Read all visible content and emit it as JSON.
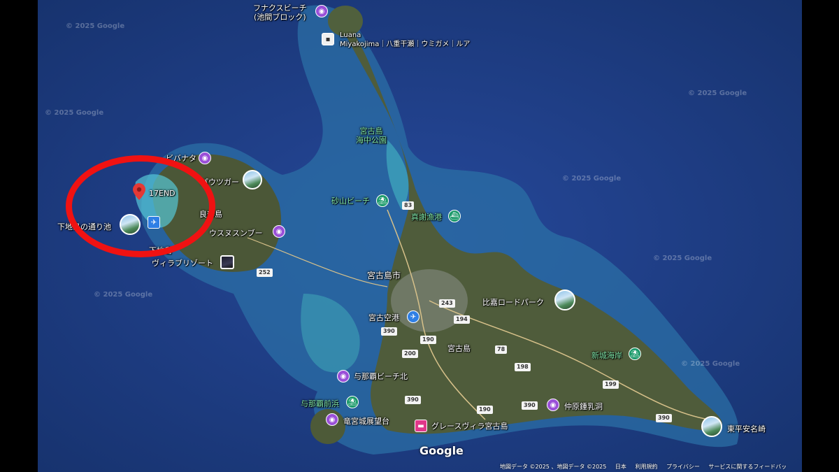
{
  "colors": {
    "water": "#1c3e86",
    "land": "#4b5a3a",
    "reef": "#43b4c8",
    "circle": "#f01212"
  },
  "places": {
    "funakusu": "フナクスビーチ\n(池間ブロック)",
    "luana": "Luana\nMiyakojima｜八重干瀬｜ウミガメ｜ルア",
    "kaichu_park": "宮古島\n海中公園",
    "sunayama": "砂山ビーチ",
    "shinjya": "真謝漁港",
    "marker_17end": "17END",
    "shimojishima_pond": "下地島の通り池",
    "irabu": "良部島",
    "usunu": "ウスヌスンブー",
    "shimojishima": "下地島",
    "villa": "ヴィラブリゾート",
    "bibanata": "ビバナタ",
    "pausoga": "パウツガー",
    "miyakojima_city": "宮古島市",
    "miyako_airport": "宮古空港",
    "miyakojima": "宮古島",
    "higa_road_park": "比嘉ロードパーク",
    "shinjo_beach": "新城海岸",
    "yonaha_north": "与那覇ビーチ北",
    "yonaha_maehama": "与那覇前浜",
    "ryugujo": "竜宮城展望台",
    "grace_villa": "グレースヴィラ宮古島",
    "nakabaru": "仲原鍾乳洞",
    "higashi_hennazaki": "東平安名崎"
  },
  "road_shields": [
    "83",
    "243",
    "194",
    "390",
    "190",
    "200",
    "78",
    "198",
    "199",
    "252"
  ],
  "watermark": "© 2025 Google",
  "logo": "Google",
  "footer": {
    "map_data": "地図データ ©2025 、地図データ ©2025",
    "country": "日本",
    "terms": "利用規約",
    "privacy": "プライバシー",
    "feedback": "サービスに関するフィードバッ"
  },
  "icons": {
    "pin_marker": "red-location-pin-icon",
    "airport": "airplane-icon",
    "beach": "beach-umbrella-icon",
    "port": "ferry-icon",
    "attraction": "camera-icon",
    "hotel": "bed-icon"
  }
}
